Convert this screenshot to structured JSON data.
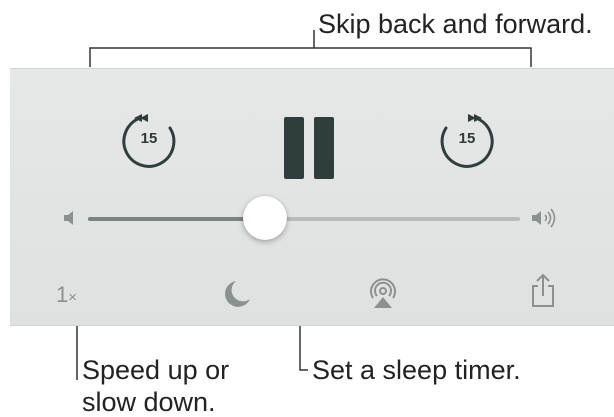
{
  "callouts": {
    "skip": "Skip back and forward.",
    "speed_line1": "Speed up or",
    "speed_line2": "slow down.",
    "sleep": "Set a sleep timer."
  },
  "controls": {
    "skip_back_seconds": "15",
    "skip_forward_seconds": "15",
    "playback_state": "playing",
    "speed_value": "1",
    "speed_suffix": "×",
    "volume_level": 0.41
  },
  "icons": {
    "skip_back": "skip-back-15-icon",
    "pause": "pause-icon",
    "skip_forward": "skip-forward-15-icon",
    "volume_low": "speaker-low-icon",
    "volume_high": "speaker-high-icon",
    "sleep": "moon-icon",
    "airplay": "airplay-icon",
    "share": "share-icon"
  },
  "colors": {
    "panel_background": "#e3e5e4",
    "primary_control": "#2f3e3c",
    "secondary_control": "#8a9190",
    "slider_track": "#b8bcbc",
    "slider_fill": "#7b8282",
    "callout_text": "#222222"
  }
}
